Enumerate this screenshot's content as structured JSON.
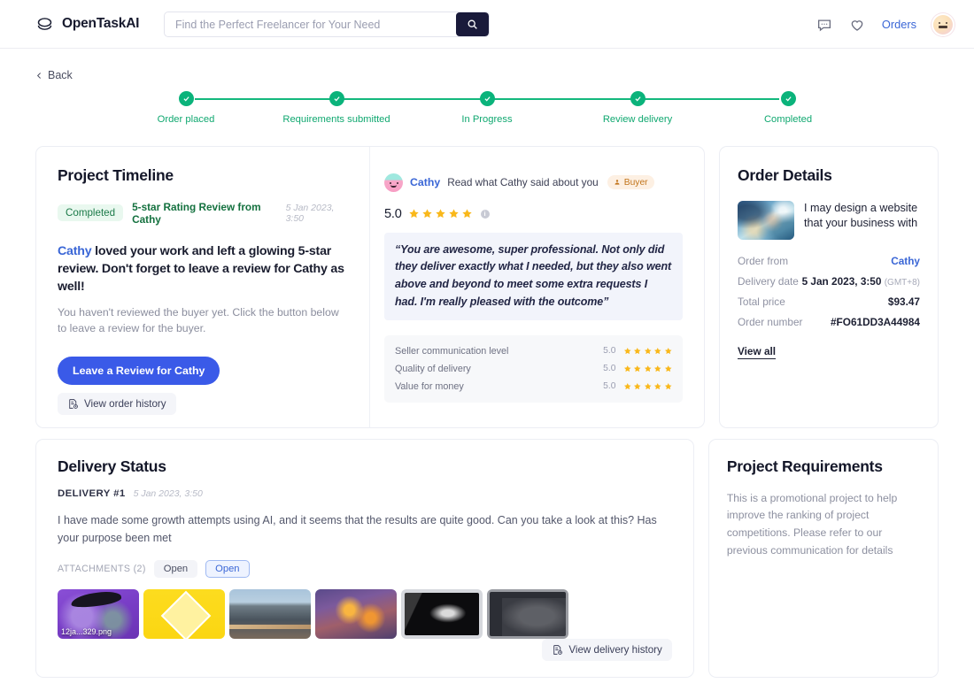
{
  "header": {
    "brand": "OpenTaskAI",
    "brand_icon": "stack-logo-icon",
    "search": {
      "value": "",
      "placeholder": "Find the Perfect Freelancer for Your Need",
      "button_icon": "search-icon"
    },
    "messages_icon": "chat-bubble-icon",
    "favorites_icon": "heart-icon",
    "orders_label": "Orders",
    "avatar_icon": "user-avatar"
  },
  "back": {
    "label": "Back",
    "icon": "chevron-left-icon"
  },
  "stepper": {
    "steps": [
      {
        "label": "Order placed",
        "state": "done"
      },
      {
        "label": "Requirements submitted",
        "state": "done"
      },
      {
        "label": "In Progress",
        "state": "done"
      },
      {
        "label": "Review delivery",
        "state": "done"
      },
      {
        "label": "Completed",
        "state": "done"
      }
    ],
    "accent": "#0bb37b"
  },
  "timeline": {
    "title": "Project Timeline",
    "status_badge": "Completed",
    "subject": "5-star Rating Review from Cathy",
    "timestamp": "5 Jan 2023, 3:50",
    "headline_name": "Cathy",
    "headline_rest": " loved your work and left a glowing 5-star review. Don't forget to leave a review for Cathy as well!",
    "sub_text": "You haven't reviewed the buyer yet. Click the button below to leave a review for the buyer.",
    "cta_label": "Leave a Review for Cathy",
    "history_label": "View order history",
    "history_icon": "document-history-icon",
    "review": {
      "reviewer": "Cathy",
      "read_what": "Read what Cathy said about you",
      "role_badge": "Buyer",
      "role_badge_icon": "person-icon",
      "score": "5.0",
      "stars": 5,
      "info_icon": "info-icon",
      "quote": "“You are awesome, super professional. Not only did they deliver exactly what I needed, but they also went above and beyond to meet some extra requests I had. I'm really pleased with the outcome”",
      "subratings": [
        {
          "label": "Seller communication level",
          "value": "5.0",
          "stars": 5
        },
        {
          "label": "Quality of delivery",
          "value": "5.0",
          "stars": 5
        },
        {
          "label": "Value for money",
          "value": "5.0",
          "stars": 5
        }
      ]
    }
  },
  "order_details": {
    "title": "Order Details",
    "thumb_icon": "order-thumbnail",
    "item_name": "I may design a website that your business with",
    "rows": [
      {
        "key": "Order from",
        "value": "Cathy",
        "style": "link"
      },
      {
        "key": "Delivery date",
        "value": "5 Jan 2023, 3:50",
        "suffix": "(GMT+8)",
        "style": "plain"
      },
      {
        "key": "Total price",
        "value": "$93.47",
        "style": "plain"
      },
      {
        "key": "Order number",
        "value": "#FO61DD3A44984",
        "style": "plain"
      }
    ],
    "view_all": "View all"
  },
  "delivery": {
    "title": "Delivery Status",
    "delivery_no": "DELIVERY #1",
    "timestamp": "5 Jan 2023, 3:50",
    "message": "I have made some growth attempts using AI, and it seems that the results are quite good. Can you take a look at this? Has your purpose been met",
    "attachments_label": "ATTACHMENTS (2)",
    "chips": [
      {
        "label": "Open",
        "active": false
      },
      {
        "label": "Open",
        "active": true
      }
    ],
    "thumbnails": [
      {
        "name": "attachment-thumb-1",
        "filename": "12ja...329.png"
      },
      {
        "name": "attachment-thumb-2",
        "filename": ""
      },
      {
        "name": "attachment-thumb-3",
        "filename": ""
      },
      {
        "name": "attachment-thumb-4",
        "filename": ""
      },
      {
        "name": "attachment-thumb-5",
        "filename": ""
      },
      {
        "name": "attachment-thumb-6",
        "filename": ""
      }
    ],
    "history_label": "View delivery history",
    "history_icon": "document-history-icon"
  },
  "requirements": {
    "title": "Project Requirements",
    "text": "This is a promotional project to help improve the ranking of project competitions. Please refer to our previous communication for details"
  },
  "colors": {
    "accent_green": "#0bb37b",
    "accent_blue": "#3a5ae8",
    "link_blue": "#3a66d6",
    "star_yellow": "#f9b81b",
    "badge_green_bg": "#e9f8ef"
  }
}
